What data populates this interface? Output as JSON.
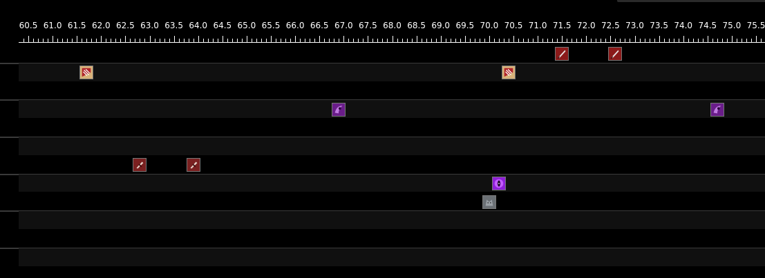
{
  "timeline": {
    "tick_start": 60.5,
    "tick_step": 0.5,
    "tick_labels": [
      "60.5",
      "61.0",
      "61.5",
      "62.0",
      "62.5",
      "63.0",
      "63.5",
      "64.0",
      "64.5",
      "65.0",
      "65.5",
      "66.0",
      "66.5",
      "67.0",
      "67.5",
      "68.0",
      "68.5",
      "69.0",
      "69.5",
      "70.0",
      "70.5",
      "71.0",
      "71.5",
      "72.0",
      "72.5",
      "73.0",
      "73.5",
      "74.0",
      "74.5",
      "75.0",
      "75.5"
    ],
    "row_count": 12,
    "events": [
      {
        "row": 0,
        "time": 71.5,
        "icon": "red-blade-icon",
        "color": "#8b1a1a"
      },
      {
        "row": 0,
        "time": 72.6,
        "icon": "red-blade-icon",
        "color": "#8b1a1a"
      },
      {
        "row": 1,
        "time": 61.7,
        "icon": "red-claw-icon",
        "color": "#b0462a"
      },
      {
        "row": 1,
        "time": 70.4,
        "icon": "red-claw-icon",
        "color": "#b0462a"
      },
      {
        "row": 3,
        "time": 66.9,
        "icon": "purple-reaper-icon",
        "color": "#6a1d8a"
      },
      {
        "row": 3,
        "time": 74.7,
        "icon": "purple-reaper-icon",
        "color": "#6a1d8a"
      },
      {
        "row": 6,
        "time": 62.8,
        "icon": "crimson-strike-icon",
        "color": "#7a2020"
      },
      {
        "row": 6,
        "time": 63.9,
        "icon": "crimson-strike-icon",
        "color": "#7a2020"
      },
      {
        "row": 7,
        "time": 70.2,
        "icon": "violet-eye-icon",
        "color": "#8e1fd6"
      },
      {
        "row": 8,
        "time": 70.0,
        "icon": "grey-wolf-icon",
        "color": "#6b7075"
      }
    ]
  }
}
